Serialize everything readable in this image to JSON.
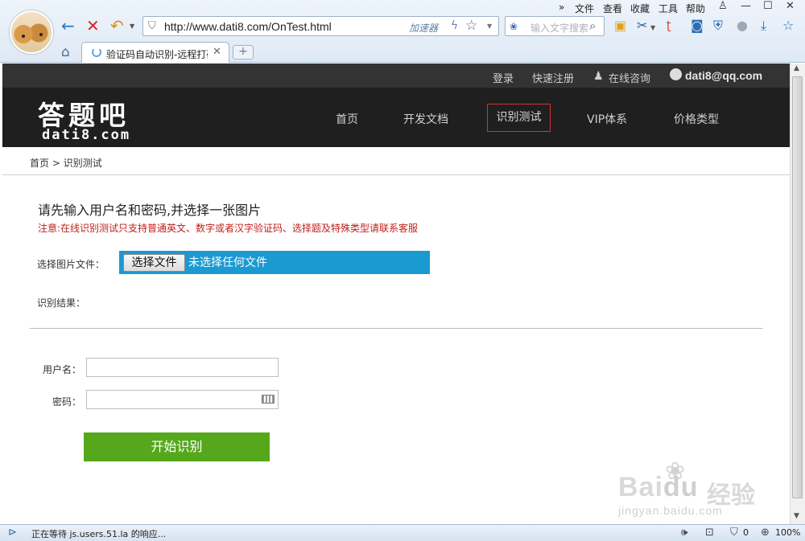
{
  "browser": {
    "url": "http://www.dati8.com/OnTest.html",
    "accelerator_label": "加速器",
    "search_placeholder": "输入文字搜索",
    "menu": [
      "文件",
      "查看",
      "收藏",
      "工具",
      "帮助"
    ],
    "overflow_label": "»",
    "tab_title": "验证码自动识别-远程打码",
    "new_tab_label": "+",
    "status_message": "正在等待 js.users.51.la 的响应...",
    "status_counter": "0",
    "zoom": "100%"
  },
  "site": {
    "topbar": {
      "login": "登录",
      "register": "快速注册",
      "online_consult": "在线咨询",
      "email": "dati8@qq.com"
    },
    "logo": {
      "name_cn": "答题吧",
      "name_en": "dati8.com"
    },
    "nav": [
      "首页",
      "开发文档",
      "识别测试",
      "VIP体系",
      "价格类型"
    ],
    "breadcrumb": "首页 > 识别测试",
    "form": {
      "heading": "请先输入用户名和密码,并选择一张图片",
      "notice": "注意:在线识别测试只支持普通英文、数字或者汉字验证码、选择题及特殊类型请联系客服",
      "file_label": "选择图片文件：",
      "file_button": "选择文件",
      "file_status": "未选择任何文件",
      "result_label": "识别结果：",
      "username_label": "用户名：",
      "username_value": "",
      "password_label": "密码：",
      "password_value": "",
      "submit_label": "开始识别"
    }
  },
  "watermark": {
    "brand": "Bai",
    "brand_suffix": "du",
    "brand_cn": "经验",
    "sub": "jingyan.baidu.com"
  },
  "colors": {
    "header_bg": "#1f1f1f",
    "topbar_bg": "#333333",
    "active_nav_border": "#d6322c",
    "notice_text": "#c0201a",
    "file_box": "#1b9ad1",
    "submit_button": "#55a81b"
  }
}
